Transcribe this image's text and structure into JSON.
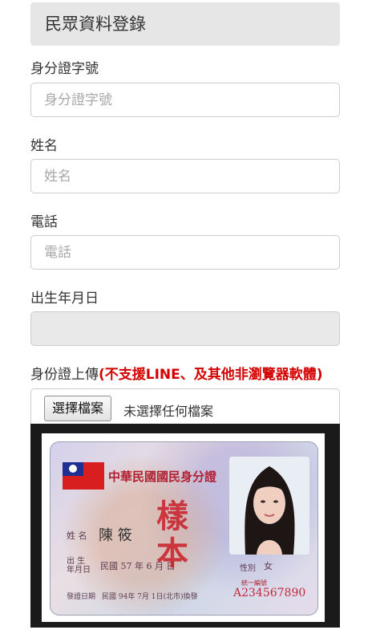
{
  "header": {
    "title": "民眾資料登錄"
  },
  "fields": {
    "id_number": {
      "label": "身分證字號",
      "placeholder": "身分證字號"
    },
    "name": {
      "label": "姓名",
      "placeholder": "姓名"
    },
    "phone": {
      "label": "電話",
      "placeholder": "電話"
    },
    "birthdate": {
      "label": "出生年月日",
      "value": ""
    }
  },
  "upload": {
    "label": "身份證上傳",
    "warning": "(不支援LINE、及其他非瀏覽器軟體)",
    "button_label": "選擇檔案",
    "status": "未選擇任何檔案"
  },
  "id_card": {
    "title": "中華民國國民身分證",
    "name_label": "姓 名",
    "name_value": "陳 筱",
    "birth_label": "出 生\n年月日",
    "birth_value": "民國 57 年 6 月 日",
    "sex_label": "性別",
    "sex_value": "女",
    "issue_label": "發證日期",
    "issue_value": "民國 94年 7月 1日(北市)換發",
    "id_prefix": "統一編號",
    "id_value": "A234567890",
    "stamp": "樣本"
  },
  "colors": {
    "warning": "#d40000",
    "panel_bg": "#e6e6e6",
    "border": "#cccccc"
  }
}
